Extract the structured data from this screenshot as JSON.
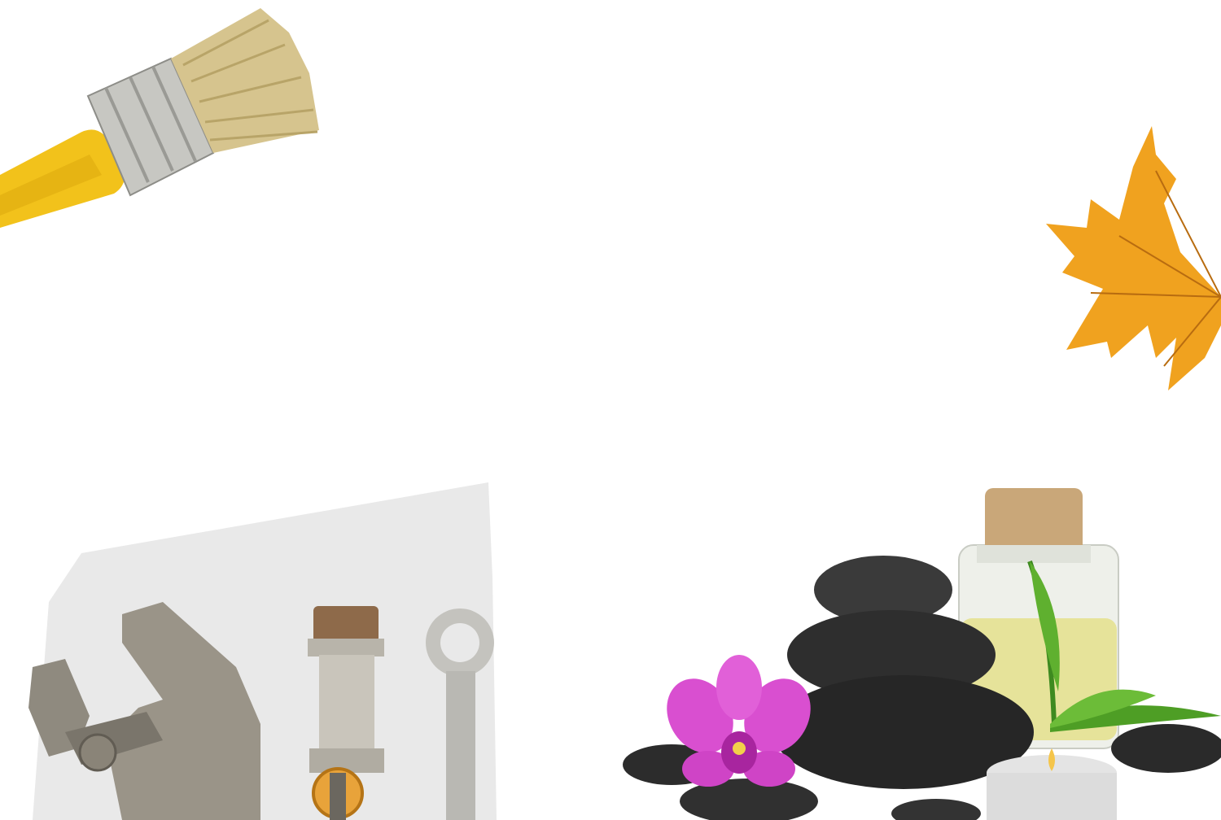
{
  "scene": {
    "background": "#ffffff",
    "objects": [
      {
        "name": "paint-brush",
        "color_handle": "#f2c21b",
        "color_ferrule": "#b9b9b4",
        "color_bristles": "#d6c48e"
      },
      {
        "name": "maple-leaf",
        "color": "#f0a21f",
        "vein_color": "#b86c10"
      },
      {
        "name": "plumbing-tools",
        "items": [
          "adjustable-wrench",
          "brass-valve-fitting",
          "combination-spanner"
        ],
        "card_color": "#e9e9e9"
      },
      {
        "name": "spa-arrangement",
        "items": [
          "black-basalt-stones",
          "pink-orchid",
          "oil-bottle-with-cork",
          "bamboo-leaves",
          "tealight-candle"
        ],
        "stone_color": "#2c2c2c",
        "orchid_color": "#d94fd0",
        "oil_color": "#e6e39a"
      }
    ]
  }
}
